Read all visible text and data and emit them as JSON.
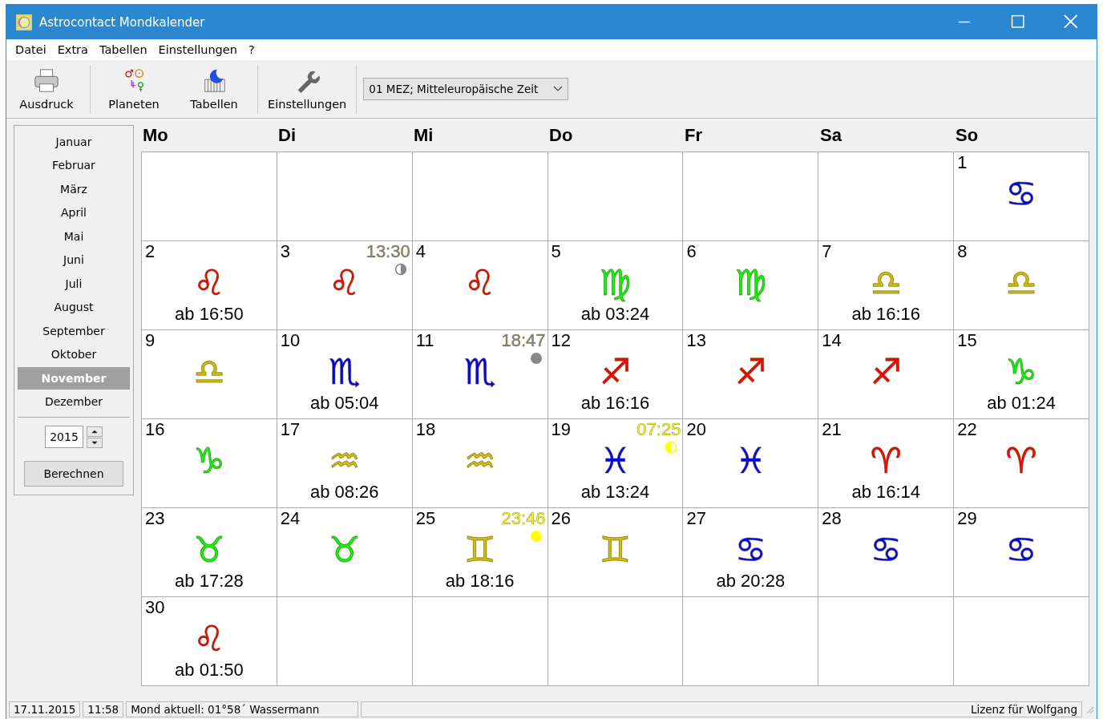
{
  "window": {
    "title": "Astrocontact Mondkalender"
  },
  "menu": [
    "Datei",
    "Extra",
    "Tabellen",
    "Einstellungen",
    "?"
  ],
  "toolbar": [
    {
      "kind": "print",
      "label": "Ausdruck"
    },
    {
      "kind": "planets",
      "label": "Planeten"
    },
    {
      "kind": "tables",
      "label": "Tabellen"
    },
    {
      "kind": "settings",
      "label": "Einstellungen"
    }
  ],
  "timezone": {
    "value": "01 MEZ; Mitteleuropäische Zeit"
  },
  "months": [
    {
      "label": "Januar",
      "selected": false
    },
    {
      "label": "Februar",
      "selected": false
    },
    {
      "label": "März",
      "selected": false
    },
    {
      "label": "April",
      "selected": false
    },
    {
      "label": "Mai",
      "selected": false
    },
    {
      "label": "Juni",
      "selected": false
    },
    {
      "label": "Juli",
      "selected": false
    },
    {
      "label": "August",
      "selected": false
    },
    {
      "label": "September",
      "selected": false
    },
    {
      "label": "Oktober",
      "selected": false
    },
    {
      "label": "November",
      "selected": true
    },
    {
      "label": "Dezember",
      "selected": false
    }
  ],
  "year": {
    "value": "2015"
  },
  "calculate_button": "Berechnen",
  "weekdays": [
    "Mo",
    "Di",
    "Mi",
    "Do",
    "Fr",
    "Sa",
    "So"
  ],
  "cells": [
    {
      "kind": "blank"
    },
    {
      "kind": "blank"
    },
    {
      "kind": "blank"
    },
    {
      "kind": "blank"
    },
    {
      "kind": "blank"
    },
    {
      "kind": "blank"
    },
    {
      "kind": "day",
      "day": "1",
      "sign": "♋",
      "color": "#0000ff"
    },
    {
      "kind": "day",
      "day": "2",
      "sign": "♌",
      "color": "#ff0000",
      "ingress": "ab 16:50"
    },
    {
      "kind": "day",
      "day": "3",
      "sign": "♌",
      "color": "#ff0000",
      "phase": {
        "kind": "last_quarter",
        "time": "13:30"
      }
    },
    {
      "kind": "day",
      "day": "4",
      "sign": "♌",
      "color": "#ff0000"
    },
    {
      "kind": "day",
      "day": "5",
      "sign": "♍",
      "color": "#00ff00",
      "ingress": "ab 03:24"
    },
    {
      "kind": "day",
      "day": "6",
      "sign": "♍",
      "color": "#00ff00"
    },
    {
      "kind": "day",
      "day": "7",
      "sign": "♎",
      "color": "#d4c000",
      "ingress": "ab 16:16"
    },
    {
      "kind": "day",
      "day": "8",
      "sign": "♎",
      "color": "#d4c000"
    },
    {
      "kind": "day",
      "day": "9",
      "sign": "♎",
      "color": "#d4c000"
    },
    {
      "kind": "day",
      "day": "10",
      "sign": "♏",
      "color": "#0000ff",
      "ingress": "ab 05:04"
    },
    {
      "kind": "day",
      "day": "11",
      "sign": "♏",
      "color": "#0000ff",
      "phase": {
        "kind": "new_moon",
        "time": "18:47"
      }
    },
    {
      "kind": "day",
      "day": "12",
      "sign": "♐",
      "color": "#ff0000",
      "ingress": "ab 16:16"
    },
    {
      "kind": "day",
      "day": "13",
      "sign": "♐",
      "color": "#ff0000"
    },
    {
      "kind": "day",
      "day": "14",
      "sign": "♐",
      "color": "#ff0000"
    },
    {
      "kind": "day",
      "day": "15",
      "sign": "♑",
      "color": "#00ff00",
      "ingress": "ab 01:24"
    },
    {
      "kind": "day",
      "day": "16",
      "sign": "♑",
      "color": "#00ff00"
    },
    {
      "kind": "day",
      "day": "17",
      "sign": "♒",
      "color": "#d4c000",
      "ingress": "ab 08:26"
    },
    {
      "kind": "day",
      "day": "18",
      "sign": "♒",
      "color": "#d4c000"
    },
    {
      "kind": "day",
      "day": "19",
      "sign": "♓",
      "color": "#0000ff",
      "ingress": "ab 13:24",
      "phase": {
        "kind": "first_quarter",
        "time": "07:25"
      }
    },
    {
      "kind": "day",
      "day": "20",
      "sign": "♓",
      "color": "#0000ff"
    },
    {
      "kind": "day",
      "day": "21",
      "sign": "♈",
      "color": "#ff0000",
      "ingress": "ab 16:14"
    },
    {
      "kind": "day",
      "day": "22",
      "sign": "♈",
      "color": "#ff0000"
    },
    {
      "kind": "day",
      "day": "23",
      "sign": "♉",
      "color": "#00ff00",
      "ingress": "ab 17:28"
    },
    {
      "kind": "day",
      "day": "24",
      "sign": "♉",
      "color": "#00ff00"
    },
    {
      "kind": "day",
      "day": "25",
      "sign": "♊",
      "color": "#d4c000",
      "ingress": "ab 18:16",
      "phase": {
        "kind": "full_moon",
        "time": "23:46"
      }
    },
    {
      "kind": "day",
      "day": "26",
      "sign": "♊",
      "color": "#d4c000"
    },
    {
      "kind": "day",
      "day": "27",
      "sign": "♋",
      "color": "#0000ff",
      "ingress": "ab 20:28"
    },
    {
      "kind": "day",
      "day": "28",
      "sign": "♋",
      "color": "#0000ff"
    },
    {
      "kind": "day",
      "day": "29",
      "sign": "♋",
      "color": "#0000ff"
    },
    {
      "kind": "day",
      "day": "30",
      "sign": "♌",
      "color": "#ff0000",
      "ingress": "ab 01:50"
    },
    {
      "kind": "blank"
    },
    {
      "kind": "blank"
    },
    {
      "kind": "blank"
    },
    {
      "kind": "blank"
    },
    {
      "kind": "blank"
    },
    {
      "kind": "blank"
    }
  ],
  "status_bar": {
    "date": "17.11.2015",
    "time": "11:58",
    "moon": "Mond aktuell: 01°58´ Wassermann",
    "license": "Lizenz für Wolfgang"
  }
}
